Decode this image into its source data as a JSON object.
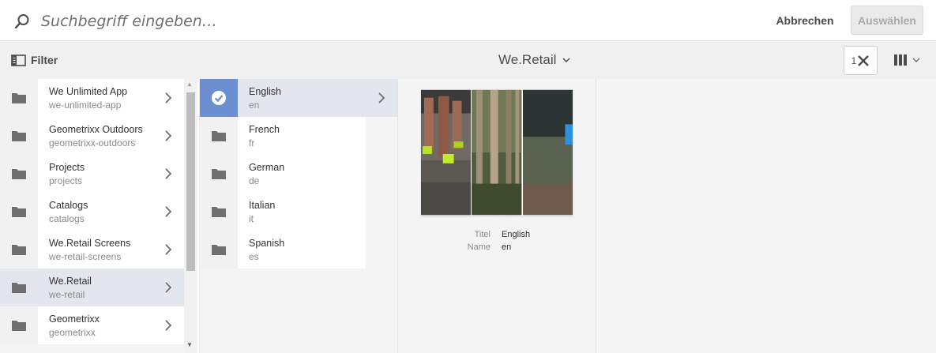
{
  "search": {
    "placeholder": "Suchbegriff eingeben…",
    "cancel_label": "Abbrechen",
    "select_label": "Auswählen"
  },
  "toolbar": {
    "filter_label": "Filter",
    "breadcrumb_title": "We.Retail",
    "selection_count": "1"
  },
  "column1": {
    "items": [
      {
        "title": "We Unlimited App",
        "name": "we-unlimited-app"
      },
      {
        "title": "Geometrixx Outdoors",
        "name": "geometrixx-outdoors"
      },
      {
        "title": "Projects",
        "name": "projects"
      },
      {
        "title": "Catalogs",
        "name": "catalogs"
      },
      {
        "title": "We.Retail Screens",
        "name": "we-retail-screens"
      },
      {
        "title": "We.Retail",
        "name": "we-retail"
      },
      {
        "title": "Geometrixx",
        "name": "geometrixx"
      }
    ]
  },
  "column2": {
    "items": [
      {
        "title": "English",
        "name": "en"
      },
      {
        "title": "French",
        "name": "fr"
      },
      {
        "title": "German",
        "name": "de"
      },
      {
        "title": "Italian",
        "name": "it"
      },
      {
        "title": "Spanish",
        "name": "es"
      }
    ]
  },
  "preview": {
    "title_label": "Titel",
    "title_value": "English",
    "name_label": "Name",
    "name_value": "en"
  },
  "colors": {
    "selected_row": "#e3e6ec",
    "check_accent": "#6b8fd0"
  },
  "icons": [
    "search-icon",
    "filter-panel-icon",
    "chevron-down-icon",
    "close-icon",
    "column-view-icon",
    "folder-icon",
    "chevron-right-icon",
    "checkmark-icon"
  ]
}
